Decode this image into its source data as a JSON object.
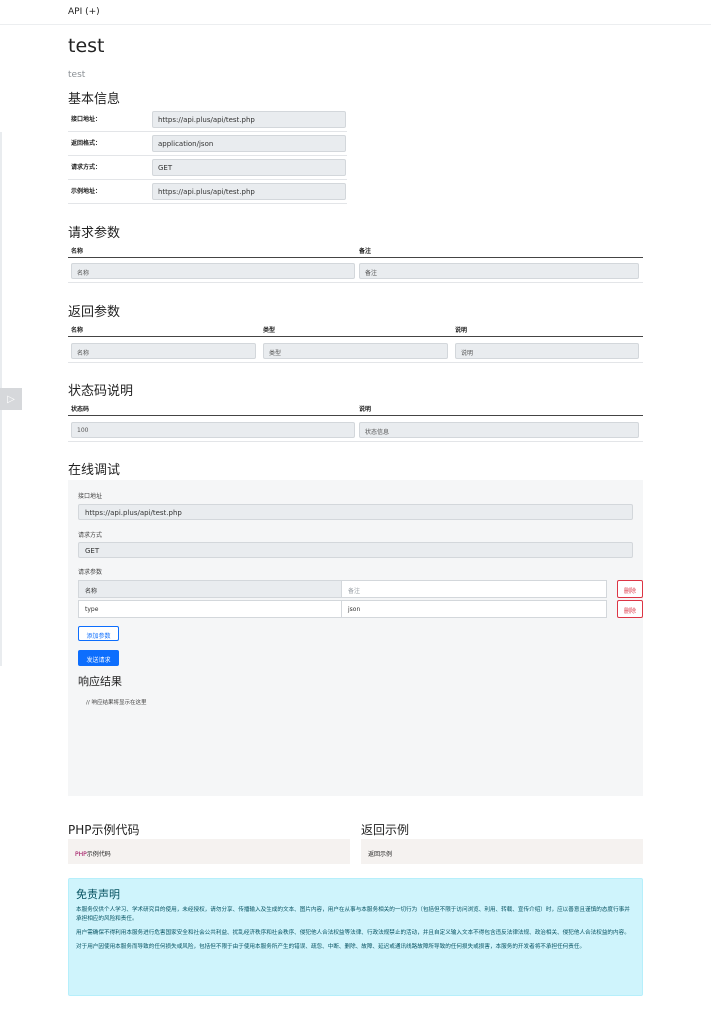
{
  "nav": {
    "brand": "API (+)",
    "toggle_icon": "▷"
  },
  "header": {
    "title": "test",
    "subtitle": "test"
  },
  "basic_info": {
    "heading": "基本信息",
    "rows": [
      {
        "label": "接口地址：",
        "value": "https://api.plus/api/test.php"
      },
      {
        "label": "返回格式：",
        "value": "application/json"
      },
      {
        "label": "请求方式：",
        "value": "GET"
      },
      {
        "label": "示例地址：",
        "value": "https://api.plus/api/test.php"
      }
    ]
  },
  "request_params": {
    "heading": "请求参数",
    "columns": [
      "名称",
      "备注"
    ],
    "row": [
      "名称",
      "备注"
    ]
  },
  "response_params": {
    "heading": "返回参数",
    "columns": [
      "名称",
      "类型",
      "说明"
    ],
    "row": [
      "名称",
      "类型",
      "说明"
    ]
  },
  "status_codes": {
    "heading": "状态码说明",
    "columns": [
      "状态码",
      "说明"
    ],
    "row": [
      "100",
      "状态信息"
    ]
  },
  "debug": {
    "heading": "在线调试",
    "url_label": "接口地址",
    "url_value": "https://api.plus/api/test.php",
    "method_label": "请求方式",
    "method_value": "GET",
    "params_label": "请求参数",
    "params": [
      {
        "name": "名称",
        "value": "备注",
        "delete": "删除"
      },
      {
        "name": "type",
        "value": "json",
        "delete": "删除"
      }
    ],
    "add_button": "添加参数",
    "send_button": "发送请求",
    "response_title": "响应结果",
    "response_placeholder": "// 响应结果将显示在这里"
  },
  "code_examples": {
    "php_heading": "PHP示例代码",
    "php_prefix": "PHP",
    "php_rest": "示例代码",
    "return_heading": "返回示例",
    "return_code": "返回示例"
  },
  "disclaimer": {
    "title": "免责声明",
    "p1": "本服务仅供个人学习、学术研究目的使用，未经授权，请勿分享、传播输入及生成的文本、图片内容，用户在从事与本服务相关的一切行为（包括但不限于访问浏览、利用、转载、宣传介绍）时，应以善意且谨慎的态度行事并承担相应的风险和责任。",
    "p2": "用户需确保不得利用本服务进行危害国家安全和社会公共利益、扰乱经济秩序和社会秩序、侵犯他人合法权益等法律、行政法规禁止的活动，并且自定义输入文本不得包含违反法律法规、政治相关、侵犯他人合法权益的内容。",
    "p3": "对于用户因使用本服务而导致的任何损失或风险，包括但不限于由于使用本服务所产生的错误、疏忽、中断、删除、故障、延迟或通讯线路故障所导致的任何损失或损害，本服务的开发者将不承担任何责任。"
  }
}
